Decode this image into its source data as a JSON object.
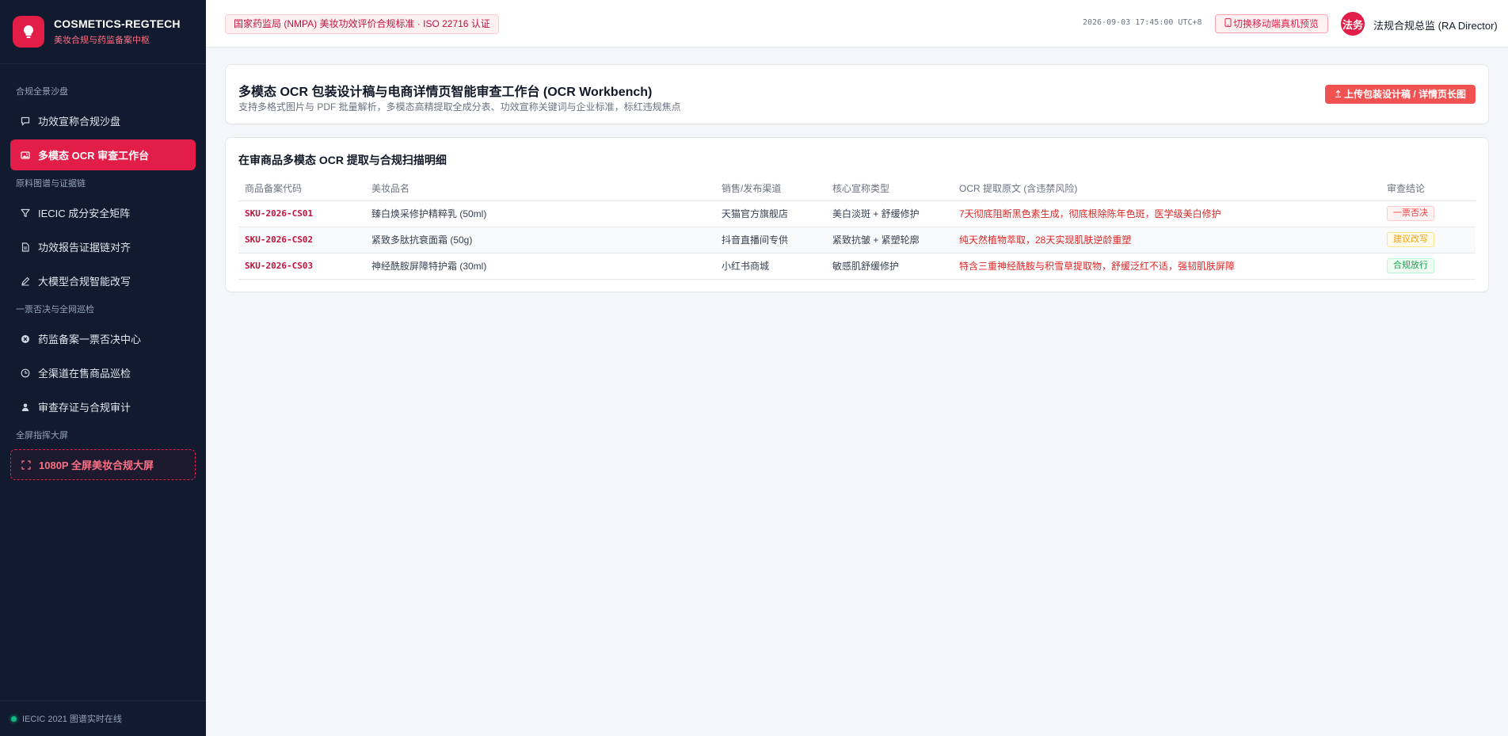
{
  "brand": {
    "title": "COSMETICS-REGTECH",
    "subtitle": "美妆合规与药监备案中枢"
  },
  "sidebar": {
    "sections": [
      {
        "title": "合规全景沙盘",
        "items": [
          {
            "label": "功效宣称合规沙盘",
            "icon": "chat-icon"
          },
          {
            "label": "多模态 OCR 审查工作台",
            "icon": "image-icon",
            "active": true
          }
        ]
      },
      {
        "title": "原料图谱与证据链",
        "items": [
          {
            "label": "IECIC 成分安全矩阵",
            "icon": "filter-icon"
          },
          {
            "label": "功效报告证据链对齐",
            "icon": "document-icon"
          },
          {
            "label": "大模型合规智能改写",
            "icon": "pen-icon"
          }
        ]
      },
      {
        "title": "一票否决与全网巡检",
        "items": [
          {
            "label": "药监备案一票否决中心",
            "icon": "x-circle-icon"
          },
          {
            "label": "全渠道在售商品巡检",
            "icon": "clock-icon"
          },
          {
            "label": "审查存证与合规审计",
            "icon": "user-icon"
          }
        ]
      },
      {
        "title": "全屏指挥大屏",
        "items": [
          {
            "label": "1080P 全屏美妆合规大屏",
            "icon": "fullscreen-icon"
          }
        ]
      }
    ],
    "footer": "IECIC 2021 图谱实时在线"
  },
  "topbar": {
    "certification": "国家药监局 (NMPA) 美妆功效评价合规标准 · ISO 22716 认证",
    "clock": "2026-09-03 17:45:00 UTC+8",
    "mobile_preview": "切换移动端真机预览",
    "avatar": "法务",
    "user": "法规合规总监 (RA Director)"
  },
  "workbench": {
    "title": "多模态 OCR 包装设计稿与电商详情页智能审查工作台 (OCR Workbench)",
    "description": "支持多格式图片与 PDF 批量解析，多模态高精提取全成分表、功效宣称关键词与企业标准，标红违规焦点",
    "upload_button": "上传包装设计稿 / 详情页长图"
  },
  "scan_table": {
    "title": "在审商品多模态 OCR 提取与合规扫描明细",
    "headers": [
      "商品备案代码",
      "美妆品名",
      "销售/发布渠道",
      "核心宣称类型",
      "OCR 提取原文 (含违禁风险)",
      "审查结论"
    ],
    "rows": [
      {
        "sku": "SKU-2026-CS01",
        "name": "臻白焕采修护精粹乳 (50ml)",
        "channel": "天猫官方旗舰店",
        "claim": "美白淡斑 + 舒缓修护",
        "ocr": "7天彻底阻断黑色素生成，彻底根除陈年色斑，医学级美白修护",
        "verdict": "一票否决",
        "status": "veto"
      },
      {
        "sku": "SKU-2026-CS02",
        "name": "紧致多肽抗衰面霜 (50g)",
        "channel": "抖音直播间专供",
        "claim": "紧致抗皱 + 紧塑轮廓",
        "ocr": "纯天然植物萃取，28天实现肌肤逆龄重塑",
        "verdict": "建议改写",
        "status": "fix"
      },
      {
        "sku": "SKU-2026-CS03",
        "name": "神经酰胺屏障特护霜 (30ml)",
        "channel": "小红书商城",
        "claim": "敏感肌舒缓修护",
        "ocr": "特含三重神经酰胺与积雪草提取物，舒缓泛红不适，强韧肌肤屏障",
        "verdict": "合规放行",
        "status": "pass"
      }
    ]
  },
  "colors": {
    "accent": "#e11d48",
    "sidebar_bg": "#111a2e",
    "risk_text": "#dc2626"
  }
}
